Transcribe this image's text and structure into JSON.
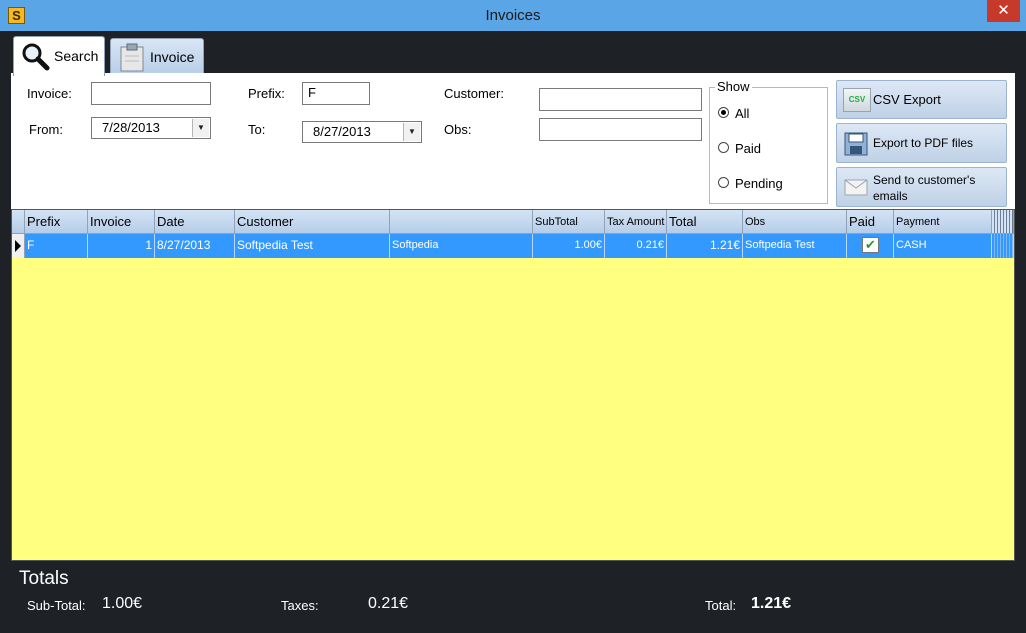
{
  "window": {
    "title": "Invoices",
    "app_icon_letter": "S",
    "close": "✕"
  },
  "tabs": [
    {
      "label": "Search"
    },
    {
      "label": "Invoice"
    }
  ],
  "search": {
    "invoice_label": "Invoice:",
    "invoice_value": "",
    "prefix_label": "Prefix:",
    "prefix_value": "F",
    "customer_label": "Customer:",
    "customer_value": "",
    "from_label": "From:",
    "from_value": "7/28/2013",
    "to_label": "To:",
    "to_value": "8/27/2013",
    "obs_label": "Obs:",
    "obs_value": ""
  },
  "show": {
    "title": "Show",
    "options": [
      {
        "label": "All",
        "selected": true
      },
      {
        "label": "Paid",
        "selected": false
      },
      {
        "label": "Pending",
        "selected": false
      }
    ]
  },
  "actions": {
    "csv_label": "CSV Export",
    "csv_icon_text": "CSV",
    "pdf_label": "Export to PDF files",
    "email_label_line1": "Send to customer's",
    "email_label_line2": "emails"
  },
  "grid": {
    "columns": [
      "Prefix",
      "Invoice",
      "Date",
      "Customer",
      "",
      "SubTotal",
      "Tax Amount",
      "Total",
      "Obs",
      "Paid",
      "Payment"
    ],
    "rows": [
      {
        "prefix": "F",
        "invoice": "1",
        "date": "8/27/2013",
        "customer": "Softpedia Test",
        "company": "Softpedia",
        "subtotal": "1.00€",
        "tax": "0.21€",
        "total": "1.21€",
        "obs": "Softpedia Test",
        "paid": true,
        "payment": "CASH"
      }
    ],
    "background_color": "#ffff80",
    "selected_color": "#3399ff"
  },
  "totals": {
    "title": "Totals",
    "subtotal_label": "Sub-Total:",
    "subtotal_value": "1.00€",
    "taxes_label": "Taxes:",
    "taxes_value": "0.21€",
    "total_label": "Total:",
    "total_value": "1.21€"
  }
}
